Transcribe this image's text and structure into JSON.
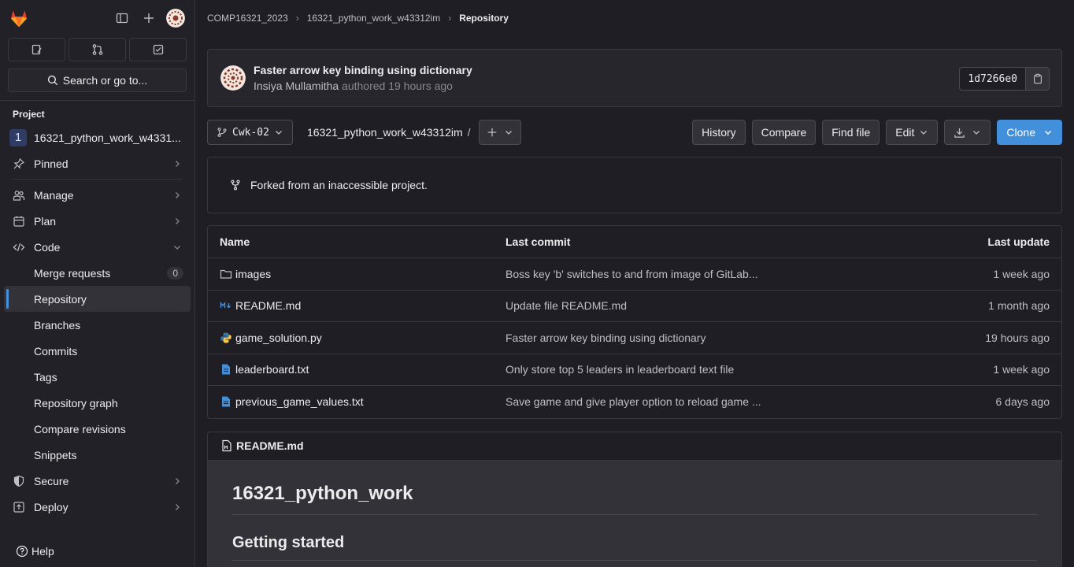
{
  "sidebar": {
    "search_label": "Search or go to...",
    "section_title": "Project",
    "project": {
      "initial": "1",
      "name": "16321_python_work_w4331..."
    },
    "items": [
      {
        "label": "Pinned"
      },
      {
        "label": "Manage"
      },
      {
        "label": "Plan"
      },
      {
        "label": "Code"
      }
    ],
    "code_sub": [
      {
        "label": "Merge requests",
        "count": "0"
      },
      {
        "label": "Repository"
      },
      {
        "label": "Branches"
      },
      {
        "label": "Commits"
      },
      {
        "label": "Tags"
      },
      {
        "label": "Repository graph"
      },
      {
        "label": "Compare revisions"
      },
      {
        "label": "Snippets"
      }
    ],
    "lower_items": [
      {
        "label": "Secure"
      },
      {
        "label": "Deploy"
      }
    ],
    "help_label": "Help"
  },
  "breadcrumb": {
    "items": [
      "COMP16321_2023",
      "16321_python_work_w43312im",
      "Repository"
    ]
  },
  "commit": {
    "title": "Faster arrow key binding using dictionary",
    "author": "Insiya Mullamitha",
    "meta": "authored 19 hours ago",
    "sha": "1d7266e0"
  },
  "toolbar": {
    "branch": "Cwk-02",
    "path": "16321_python_work_w43312im",
    "path_sep": "/",
    "history": "History",
    "compare": "Compare",
    "find_file": "Find file",
    "edit": "Edit",
    "clone": "Clone"
  },
  "fork_notice": "Forked from an inaccessible project.",
  "files": {
    "headers": {
      "name": "Name",
      "last_commit": "Last commit",
      "last_update": "Last update"
    },
    "rows": [
      {
        "name": "images",
        "type": "folder-icon",
        "commit": "Boss key 'b' switches to and from image of GitLab...",
        "date": "1 week ago"
      },
      {
        "name": "README.md",
        "type": "markdown-icon",
        "commit": "Update file README.md",
        "date": "1 month ago"
      },
      {
        "name": "game_solution.py",
        "type": "python-icon",
        "commit": "Faster arrow key binding using dictionary",
        "date": "19 hours ago"
      },
      {
        "name": "leaderboard.txt",
        "type": "text-file-icon",
        "commit": "Only store top 5 leaders in leaderboard text file",
        "date": "1 week ago"
      },
      {
        "name": "previous_game_values.txt",
        "type": "text-file-icon",
        "commit": "Save game and give player option to reload game ...",
        "date": "6 days ago"
      }
    ]
  },
  "readme": {
    "filename": "README.md",
    "h1": "16321_python_work",
    "h2": "Getting started"
  },
  "colors": {
    "accent": "#428fdc",
    "background": "#1f1e24",
    "sidebar": "#232128",
    "logo": "#e24329"
  }
}
